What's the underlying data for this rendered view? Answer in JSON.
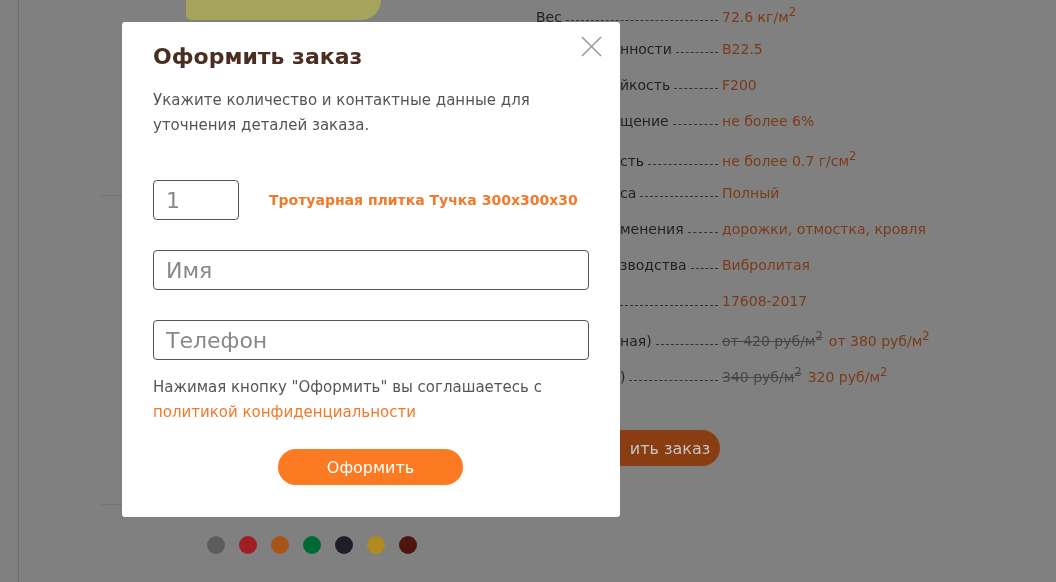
{
  "background": {
    "specs": [
      {
        "label": "Вес",
        "value": "72.6 кг/м$^{2}$"
      },
      {
        "label": "нности",
        "value": "B22.5"
      },
      {
        "label": "йкость",
        "value": "F200"
      },
      {
        "label": "щение",
        "value": "не более 6%"
      },
      {
        "label": "сть",
        "value": "не более 0.7 г/см$^{2}$"
      },
      {
        "label": "са",
        "value": "Полный"
      },
      {
        "label": "менения",
        "value": "дорожки, отмостка, кровля"
      },
      {
        "label": "зводства",
        "value": "Вибролитая"
      },
      {
        "value": "17608-2017"
      },
      {
        "label": "ная)",
        "old_price": "от 420 руб/м$^{2}$",
        "value": "от 380 руб/м$^{2}$"
      },
      {
        "label": ")",
        "old_price": "340 руб/м$^{2}$",
        "value": "320 руб/м$^{2}$"
      }
    ],
    "order_button": "ить заказ",
    "colors": [
      {
        "color": "#5c5c5c"
      },
      {
        "color": "#a01d22"
      },
      {
        "color": "#a65418"
      },
      {
        "color": "#006a35"
      },
      {
        "color": "#1e1e2a"
      },
      {
        "color": "#b08b22"
      },
      {
        "color": "#4e1511"
      }
    ]
  },
  "dialog": {
    "title": "Оформить заказ",
    "description": "Укажите количество и контактные данные для уточнения деталей заказа.",
    "quantity": "1",
    "product": "Тротуарная плитка Тучка 300x300x30",
    "name_field": {
      "placeholder": "Имя"
    },
    "phone_field": {
      "placeholder": "Телефон"
    },
    "consent": "Нажимая кнопку \"Оформить\" вы соглашаетесь с",
    "policy_link": "политикой конфиденциальности",
    "submit": "Оформить"
  }
}
